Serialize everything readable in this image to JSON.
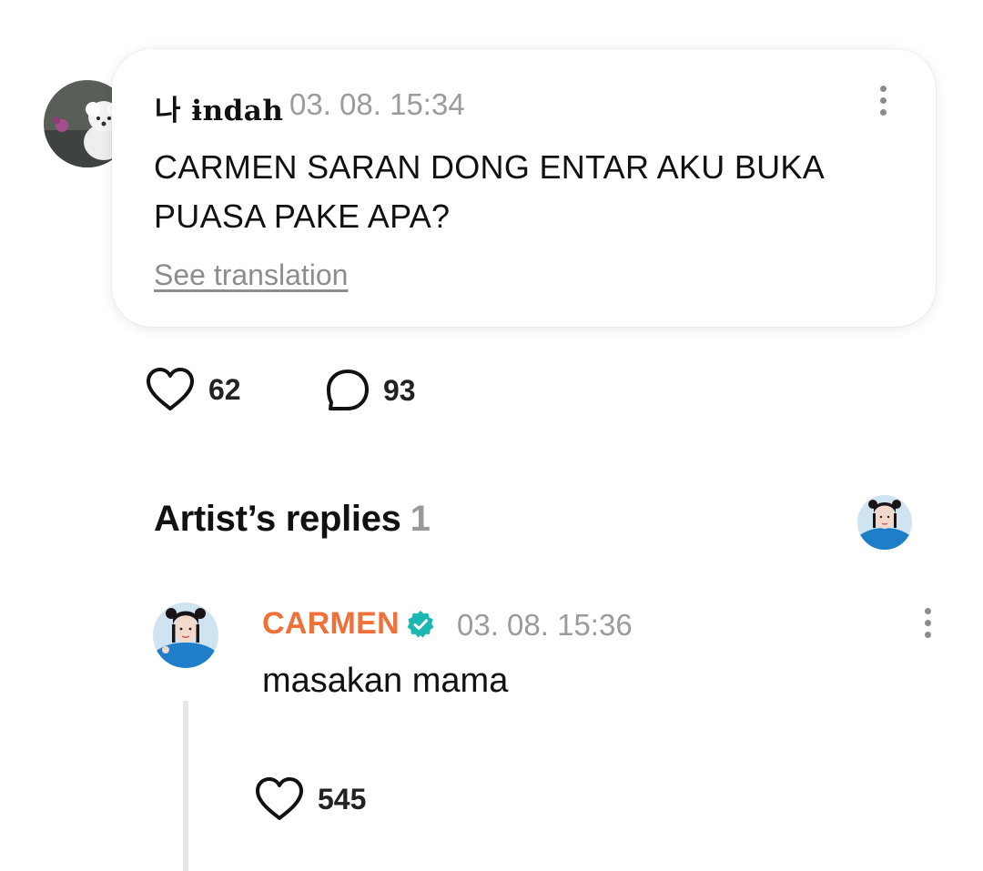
{
  "post": {
    "username": "나 ɨndah",
    "timestamp": "03. 08. 15:34",
    "text": "CARMEN SARAN DONG ENTAR AKU BUKA PUASA PAKE APA?",
    "see_translation": "See translation",
    "likes": "62",
    "comments": "93",
    "avatar_icon": "white-dog-avatar"
  },
  "artist_replies": {
    "title": "Artist’s replies",
    "count": "1",
    "avatar_icon": "artist-avatar"
  },
  "reply": {
    "username": "CARMEN",
    "username_color": "#f0703a",
    "verified_color": "#1ab8b0",
    "verified_icon": "verified-badge-icon",
    "timestamp": "03. 08. 15:36",
    "text": "masakan mama",
    "likes": "545"
  },
  "icons": {
    "like": "heart-outline-icon",
    "comment": "speech-bubble-icon",
    "more": "more-vertical-icon"
  }
}
